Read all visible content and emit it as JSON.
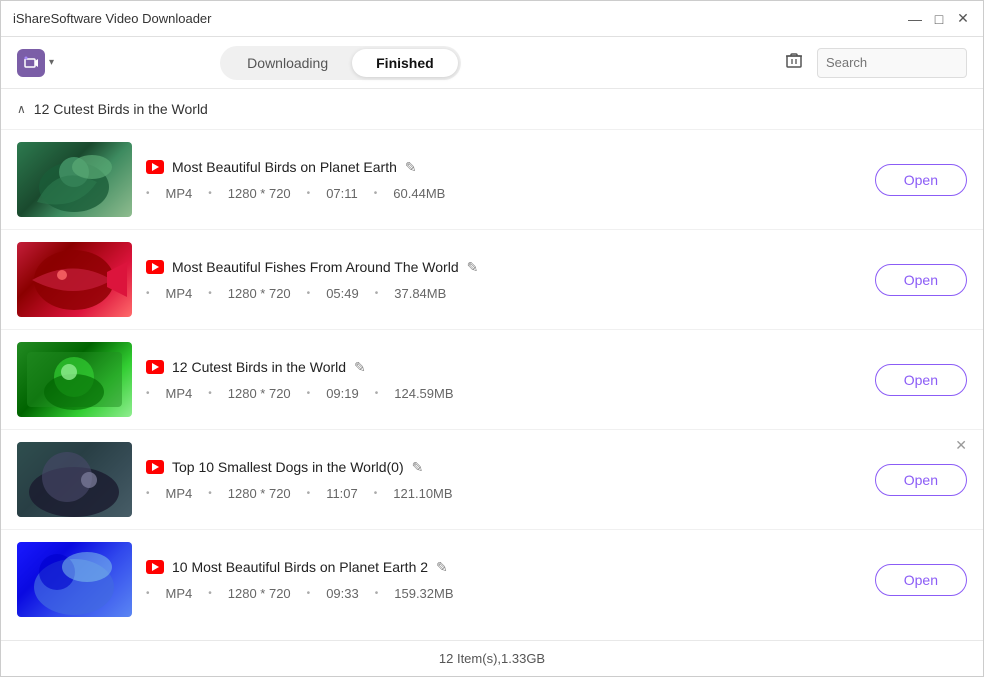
{
  "titleBar": {
    "title": "iShareSoftware Video Downloader",
    "controls": {
      "minimize": "—",
      "maximize": "□",
      "close": "✕"
    }
  },
  "toolbar": {
    "logoAlt": "iShare logo",
    "tabs": [
      {
        "id": "downloading",
        "label": "Downloading",
        "active": false
      },
      {
        "id": "finished",
        "label": "Finished",
        "active": true
      }
    ],
    "deleteTitle": "Delete",
    "searchPlaceholder": "Search"
  },
  "group": {
    "title": "12 Cutest Birds in the World",
    "collapsed": false,
    "collapseSymbol": "∧"
  },
  "videos": [
    {
      "id": 1,
      "title": "Most Beautiful Birds on Planet Earth",
      "format": "MP4",
      "resolution": "1280 * 720",
      "duration": "07:11",
      "size": "60.44MB",
      "thumbClass": "thumb-1",
      "hasClose": false
    },
    {
      "id": 2,
      "title": "Most Beautiful Fishes From Around The World",
      "format": "MP4",
      "resolution": "1280 * 720",
      "duration": "05:49",
      "size": "37.84MB",
      "thumbClass": "thumb-2",
      "hasClose": false
    },
    {
      "id": 3,
      "title": "12 Cutest Birds in the World",
      "format": "MP4",
      "resolution": "1280 * 720",
      "duration": "09:19",
      "size": "124.59MB",
      "thumbClass": "thumb-3",
      "hasClose": false
    },
    {
      "id": 4,
      "title": "Top 10 Smallest Dogs in the World(0)",
      "format": "MP4",
      "resolution": "1280 * 720",
      "duration": "11:07",
      "size": "121.10MB",
      "thumbClass": "thumb-4",
      "hasClose": true
    },
    {
      "id": 5,
      "title": "10 Most Beautiful Birds on Planet Earth 2",
      "format": "MP4",
      "resolution": "1280 * 720",
      "duration": "09:33",
      "size": "159.32MB",
      "thumbClass": "thumb-5",
      "hasClose": false
    }
  ],
  "footer": {
    "summary": "12 Item(s),1.33GB"
  },
  "buttons": {
    "openLabel": "Open"
  }
}
